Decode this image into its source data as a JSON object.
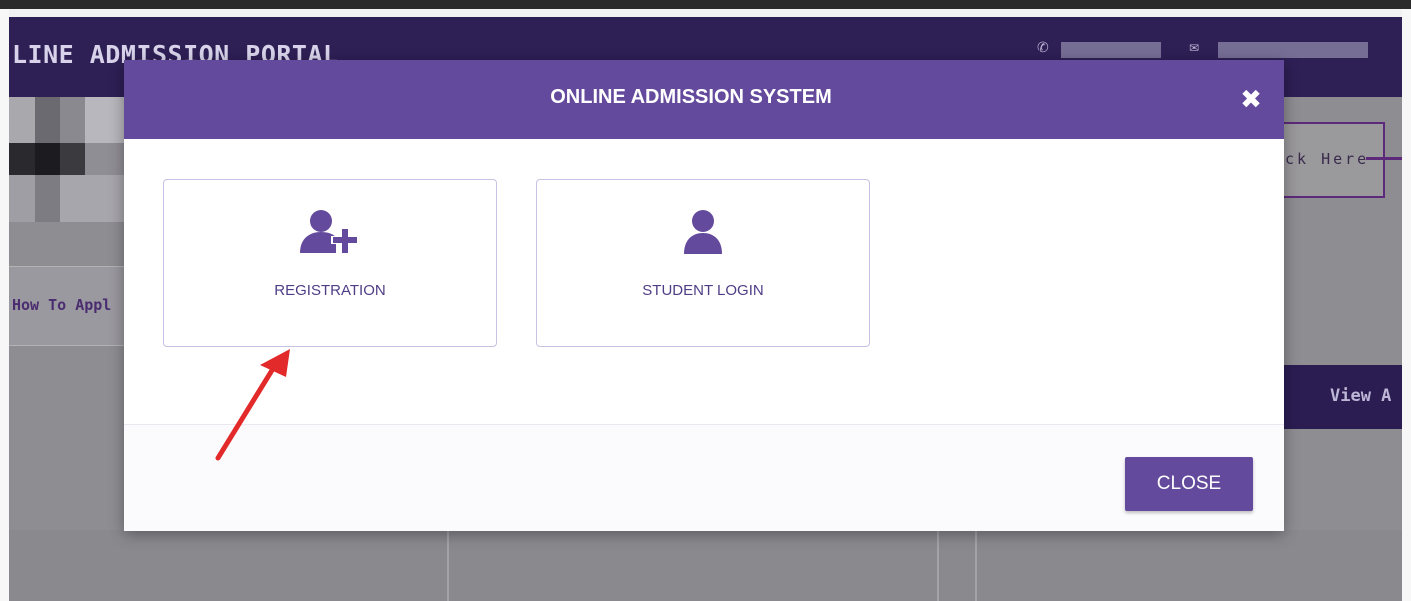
{
  "background_page": {
    "header_title": "LINE ADMISSION PORTAL",
    "click_here_text": "ck Here",
    "how_to_apply_text": "How To Appl",
    "view_all_text": "View A",
    "header_color": "#2e1f55"
  },
  "modal": {
    "title": "ONLINE ADMISSION SYSTEM",
    "options": [
      {
        "label": "REGISTRATION",
        "icon": "user-plus-icon"
      },
      {
        "label": "STUDENT LOGIN",
        "icon": "user-icon"
      }
    ],
    "close_label": "CLOSE",
    "accent_color": "#644a9c"
  },
  "annotation": {
    "arrow_color": "#e32a2a",
    "points_to": "REGISTRATION"
  }
}
